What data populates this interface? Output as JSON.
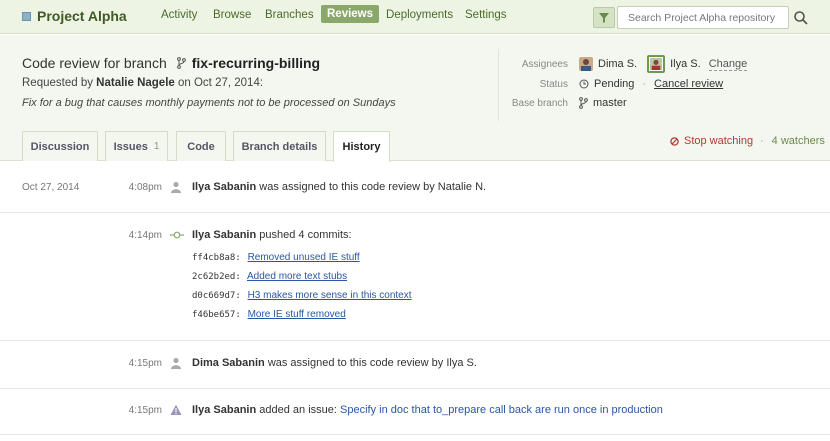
{
  "nav": {
    "project": "Project Alpha",
    "links": [
      "Activity",
      "Browse",
      "Branches",
      "Reviews",
      "Deployments",
      "Settings"
    ],
    "active": "Reviews",
    "search_placeholder": "Search Project Alpha repository"
  },
  "review": {
    "title_prefix": "Code review for branch",
    "branch": "fix-recurring-billing",
    "requested_by_prefix": "Requested by",
    "requester": "Natalie Nagele",
    "requested_on": "on Oct 27, 2014:",
    "description": "Fix for a bug that causes monthly payments not to be processed on Sundays"
  },
  "meta": {
    "assignees_label": "Assignees",
    "assignee_1": "Dima S.",
    "assignee_2": "Ilya S.",
    "change_label": "Change",
    "status_label": "Status",
    "status_value": "Pending",
    "cancel_label": "Cancel review",
    "base_label": "Base branch",
    "base_value": "master"
  },
  "tabs": [
    {
      "label": "Discussion"
    },
    {
      "label": "Issues",
      "count": "1"
    },
    {
      "label": "Code"
    },
    {
      "label": "Branch details"
    },
    {
      "label": "History"
    }
  ],
  "watch": {
    "stop_label": "Stop watching",
    "watchers_label": "4 watchers"
  },
  "history": {
    "date": "Oct 27, 2014",
    "events": [
      {
        "time": "4:08pm",
        "actor": "Ilya Sabanin",
        "text": "was assigned to this code review by Natalie N."
      },
      {
        "time": "4:14pm",
        "actor": "Ilya Sabanin",
        "text": "pushed 4 commits:",
        "commits": [
          {
            "sha": "ff4cb8a8:",
            "msg": "Removed unused IE stuff"
          },
          {
            "sha": "2c62b2ed:",
            "msg": "Added more text stubs"
          },
          {
            "sha": "d0c669d7:",
            "msg": "H3 makes more sense in this context"
          },
          {
            "sha": "f46be657:",
            "msg": "More IE stuff removed"
          }
        ]
      },
      {
        "time": "4:15pm",
        "actor": "Dima Sabanin",
        "text": "was assigned to this code review by Ilya S."
      },
      {
        "time": "4:15pm",
        "actor": "Ilya Sabanin",
        "text": "added an issue:",
        "link": "Specify in doc that to_prepare call back are run once in production"
      }
    ]
  },
  "colors": {
    "nav_bg": "#eef4e4",
    "nav_active": "#8aa86a",
    "link": "#2956a4",
    "stop_watching": "#b23a2f"
  }
}
